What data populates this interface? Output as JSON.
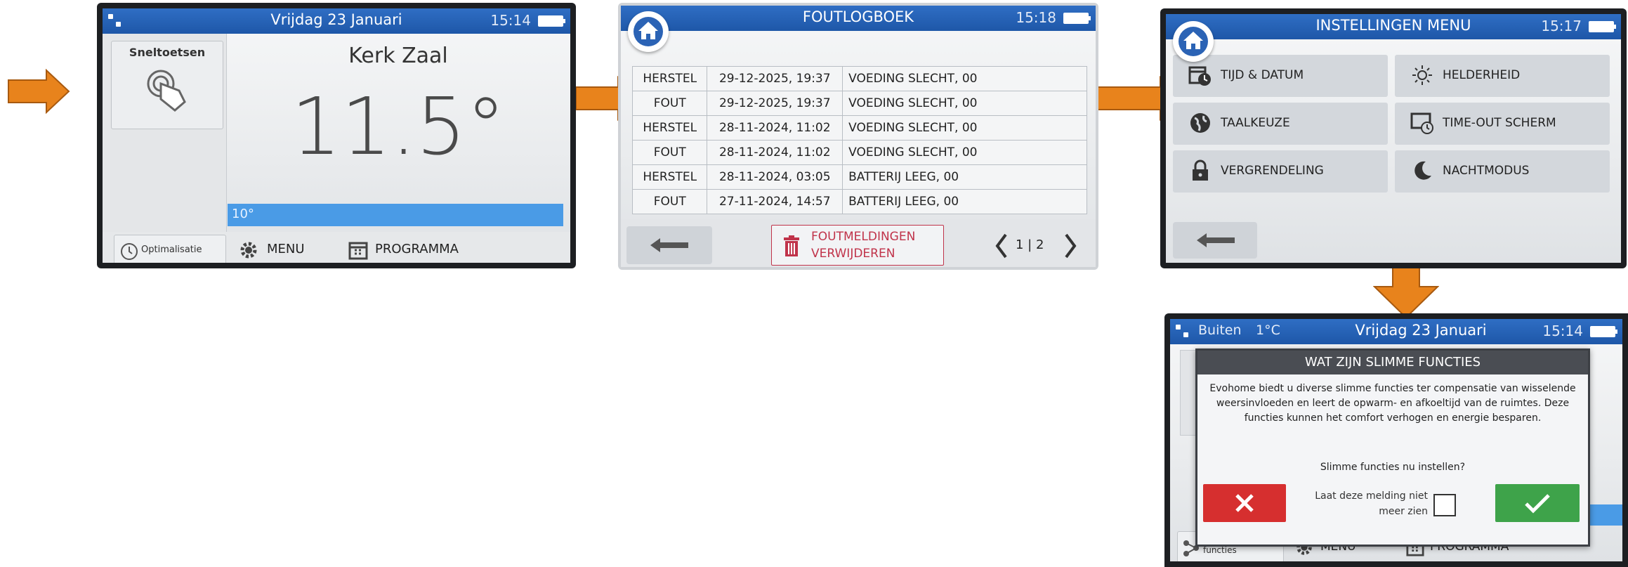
{
  "colors": {
    "arrow": "#e8831c",
    "topbar": "#2461b3",
    "temp_bar": "#4a9be6",
    "cancel_red": "#d62f2f",
    "confirm_green": "#3ea34a",
    "delete_red": "#c0334a"
  },
  "screen1": {
    "date": "Vrijdag 23 Januari",
    "time": "15:14",
    "shortcuts_label": "Sneltoetsen",
    "zone_name": "Kerk Zaal",
    "temperature": "11.5°",
    "setpoint": "10°",
    "optimisation_label": "Optimalisatie",
    "menu_label": "MENU",
    "program_label": "PROGRAMMA"
  },
  "screen2": {
    "title": "FOUTLOGBOEK",
    "time": "15:18",
    "rows": [
      {
        "type": "HERSTEL",
        "datetime": "29-12-2025, 19:37",
        "message": "VOEDING SLECHT, 00"
      },
      {
        "type": "FOUT",
        "datetime": "29-12-2025, 19:37",
        "message": "VOEDING SLECHT, 00"
      },
      {
        "type": "HERSTEL",
        "datetime": "28-11-2024, 11:02",
        "message": "VOEDING SLECHT, 00"
      },
      {
        "type": "FOUT",
        "datetime": "28-11-2024, 11:02",
        "message": "VOEDING SLECHT, 00"
      },
      {
        "type": "HERSTEL",
        "datetime": "28-11-2024, 03:05",
        "message": "BATTERIJ LEEG, 00"
      },
      {
        "type": "FOUT",
        "datetime": "27-11-2024, 14:57",
        "message": "BATTERIJ LEEG, 00"
      }
    ],
    "delete_line1": "FOUTMELDINGEN",
    "delete_line2": "VERWIJDEREN",
    "page_indicator": "1 | 2"
  },
  "screen3": {
    "title": "INSTELLINGEN MENU",
    "time": "15:17",
    "items": [
      {
        "label": "TIJD & DATUM",
        "icon": "calendar-clock-icon"
      },
      {
        "label": "HELDERHEID",
        "icon": "sun-icon"
      },
      {
        "label": "TAALKEUZE",
        "icon": "globe-icon"
      },
      {
        "label": "TIME-OUT SCHERM",
        "icon": "screen-timer-icon"
      },
      {
        "label": "VERGRENDELING",
        "icon": "lock-icon"
      },
      {
        "label": "NACHTMODUS",
        "icon": "moon-icon"
      }
    ]
  },
  "screen4": {
    "outside_label": "Buiten",
    "outside_temp": "1°C",
    "date": "Vrijdag 23 Januari",
    "time": "15:14",
    "dialog_title": "WAT ZIJN SLIMME FUNCTIES",
    "dialog_body": "Evohome biedt u diverse slimme functies ter compensatie van wisselende weersinvloeden en leert de opwarm- en afkoeltijd van de ruimtes. Deze functies kunnen het comfort verhogen en energie besparen.",
    "dialog_question": "Slimme functies nu instellen?",
    "dont_show_label": "Laat deze melding niet meer zien",
    "smart_label": "Slimme functies",
    "menu_label": "MENU",
    "program_label": "PROGRAMMA"
  }
}
